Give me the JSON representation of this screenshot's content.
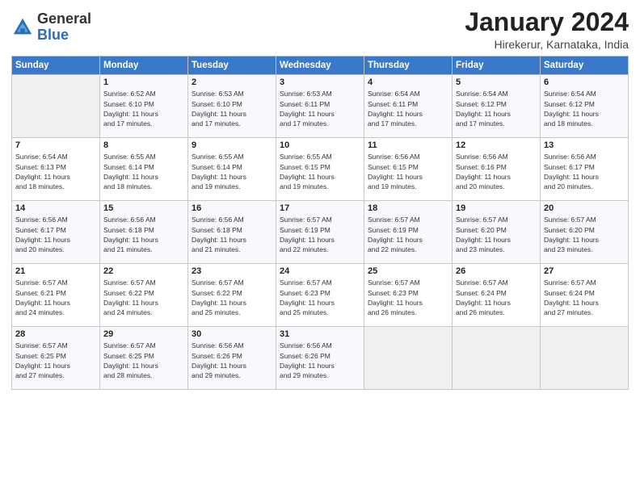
{
  "logo": {
    "general": "General",
    "blue": "Blue"
  },
  "title": "January 2024",
  "location": "Hirekerur, Karnataka, India",
  "days_of_week": [
    "Sunday",
    "Monday",
    "Tuesday",
    "Wednesday",
    "Thursday",
    "Friday",
    "Saturday"
  ],
  "weeks": [
    [
      {
        "day": "",
        "info": ""
      },
      {
        "day": "1",
        "info": "Sunrise: 6:52 AM\nSunset: 6:10 PM\nDaylight: 11 hours\nand 17 minutes."
      },
      {
        "day": "2",
        "info": "Sunrise: 6:53 AM\nSunset: 6:10 PM\nDaylight: 11 hours\nand 17 minutes."
      },
      {
        "day": "3",
        "info": "Sunrise: 6:53 AM\nSunset: 6:11 PM\nDaylight: 11 hours\nand 17 minutes."
      },
      {
        "day": "4",
        "info": "Sunrise: 6:54 AM\nSunset: 6:11 PM\nDaylight: 11 hours\nand 17 minutes."
      },
      {
        "day": "5",
        "info": "Sunrise: 6:54 AM\nSunset: 6:12 PM\nDaylight: 11 hours\nand 17 minutes."
      },
      {
        "day": "6",
        "info": "Sunrise: 6:54 AM\nSunset: 6:12 PM\nDaylight: 11 hours\nand 18 minutes."
      }
    ],
    [
      {
        "day": "7",
        "info": "Sunrise: 6:54 AM\nSunset: 6:13 PM\nDaylight: 11 hours\nand 18 minutes."
      },
      {
        "day": "8",
        "info": "Sunrise: 6:55 AM\nSunset: 6:14 PM\nDaylight: 11 hours\nand 18 minutes."
      },
      {
        "day": "9",
        "info": "Sunrise: 6:55 AM\nSunset: 6:14 PM\nDaylight: 11 hours\nand 19 minutes."
      },
      {
        "day": "10",
        "info": "Sunrise: 6:55 AM\nSunset: 6:15 PM\nDaylight: 11 hours\nand 19 minutes."
      },
      {
        "day": "11",
        "info": "Sunrise: 6:56 AM\nSunset: 6:15 PM\nDaylight: 11 hours\nand 19 minutes."
      },
      {
        "day": "12",
        "info": "Sunrise: 6:56 AM\nSunset: 6:16 PM\nDaylight: 11 hours\nand 20 minutes."
      },
      {
        "day": "13",
        "info": "Sunrise: 6:56 AM\nSunset: 6:17 PM\nDaylight: 11 hours\nand 20 minutes."
      }
    ],
    [
      {
        "day": "14",
        "info": "Sunrise: 6:56 AM\nSunset: 6:17 PM\nDaylight: 11 hours\nand 20 minutes."
      },
      {
        "day": "15",
        "info": "Sunrise: 6:56 AM\nSunset: 6:18 PM\nDaylight: 11 hours\nand 21 minutes."
      },
      {
        "day": "16",
        "info": "Sunrise: 6:56 AM\nSunset: 6:18 PM\nDaylight: 11 hours\nand 21 minutes."
      },
      {
        "day": "17",
        "info": "Sunrise: 6:57 AM\nSunset: 6:19 PM\nDaylight: 11 hours\nand 22 minutes."
      },
      {
        "day": "18",
        "info": "Sunrise: 6:57 AM\nSunset: 6:19 PM\nDaylight: 11 hours\nand 22 minutes."
      },
      {
        "day": "19",
        "info": "Sunrise: 6:57 AM\nSunset: 6:20 PM\nDaylight: 11 hours\nand 23 minutes."
      },
      {
        "day": "20",
        "info": "Sunrise: 6:57 AM\nSunset: 6:20 PM\nDaylight: 11 hours\nand 23 minutes."
      }
    ],
    [
      {
        "day": "21",
        "info": "Sunrise: 6:57 AM\nSunset: 6:21 PM\nDaylight: 11 hours\nand 24 minutes."
      },
      {
        "day": "22",
        "info": "Sunrise: 6:57 AM\nSunset: 6:22 PM\nDaylight: 11 hours\nand 24 minutes."
      },
      {
        "day": "23",
        "info": "Sunrise: 6:57 AM\nSunset: 6:22 PM\nDaylight: 11 hours\nand 25 minutes."
      },
      {
        "day": "24",
        "info": "Sunrise: 6:57 AM\nSunset: 6:23 PM\nDaylight: 11 hours\nand 25 minutes."
      },
      {
        "day": "25",
        "info": "Sunrise: 6:57 AM\nSunset: 6:23 PM\nDaylight: 11 hours\nand 26 minutes."
      },
      {
        "day": "26",
        "info": "Sunrise: 6:57 AM\nSunset: 6:24 PM\nDaylight: 11 hours\nand 26 minutes."
      },
      {
        "day": "27",
        "info": "Sunrise: 6:57 AM\nSunset: 6:24 PM\nDaylight: 11 hours\nand 27 minutes."
      }
    ],
    [
      {
        "day": "28",
        "info": "Sunrise: 6:57 AM\nSunset: 6:25 PM\nDaylight: 11 hours\nand 27 minutes."
      },
      {
        "day": "29",
        "info": "Sunrise: 6:57 AM\nSunset: 6:25 PM\nDaylight: 11 hours\nand 28 minutes."
      },
      {
        "day": "30",
        "info": "Sunrise: 6:56 AM\nSunset: 6:26 PM\nDaylight: 11 hours\nand 29 minutes."
      },
      {
        "day": "31",
        "info": "Sunrise: 6:56 AM\nSunset: 6:26 PM\nDaylight: 11 hours\nand 29 minutes."
      },
      {
        "day": "",
        "info": ""
      },
      {
        "day": "",
        "info": ""
      },
      {
        "day": "",
        "info": ""
      }
    ]
  ]
}
